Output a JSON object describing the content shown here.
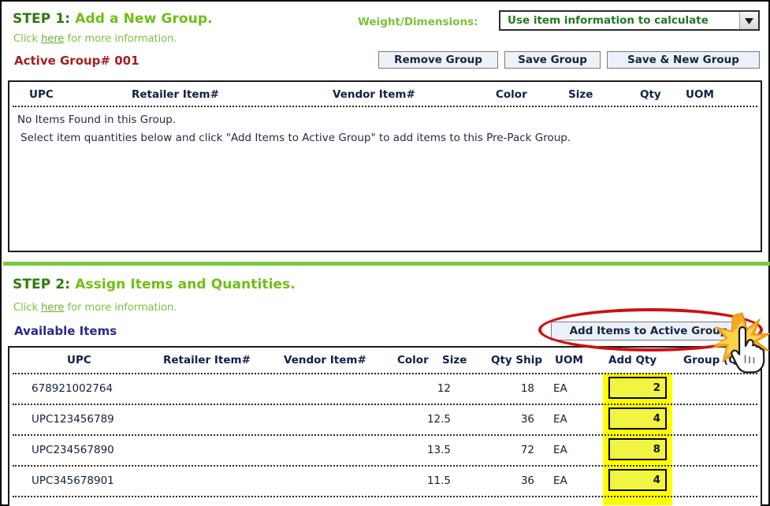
{
  "step1": {
    "heading_num": "STEP 1:",
    "heading_text": "Add a New Group.",
    "help_prefix": "Click ",
    "help_link": "here",
    "help_suffix": " for more information.",
    "active_group": "Active Group# 001",
    "weight_label": "Weight/Dimensions:",
    "weight_value": "Use item information to calculate",
    "buttons": {
      "remove": "Remove Group",
      "save": "Save Group",
      "save_new": "Save & New Group"
    },
    "table": {
      "headers": [
        "UPC",
        "Retailer Item#",
        "Vendor Item#",
        "Color",
        "Size",
        "Qty",
        "UOM"
      ],
      "empty_line1": "No Items Found in this Group.",
      "empty_line2": "Select item quantities below and click \"Add Items to Active Group\" to add items to this Pre-Pack Group."
    }
  },
  "step2": {
    "heading_num": "STEP 2:",
    "heading_text": "Assign Items and Quantities.",
    "help_prefix": "Click ",
    "help_link": "here",
    "help_suffix": " for more information.",
    "available_items": "Available Items",
    "add_button": "Add Items to Active Group",
    "table": {
      "headers": [
        "UPC",
        "Retailer Item#",
        "Vendor Item#",
        "Color",
        "Size",
        "Qty Ship",
        "UOM",
        "Add Qty",
        "Group (Q"
      ],
      "rows": [
        {
          "upc": "678921002764",
          "retailer_item": "",
          "vendor_item": "",
          "color": "",
          "size": "12",
          "qty_ship": "18",
          "uom": "EA",
          "add_qty": "2",
          "group": ""
        },
        {
          "upc": "UPC123456789",
          "retailer_item": "",
          "vendor_item": "",
          "color": "",
          "size": "12.5",
          "qty_ship": "36",
          "uom": "EA",
          "add_qty": "4",
          "group": ""
        },
        {
          "upc": "UPC234567890",
          "retailer_item": "",
          "vendor_item": "",
          "color": "",
          "size": "13.5",
          "qty_ship": "72",
          "uom": "EA",
          "add_qty": "8",
          "group": ""
        },
        {
          "upc": "UPC345678901",
          "retailer_item": "",
          "vendor_item": "",
          "color": "",
          "size": "11.5",
          "qty_ship": "36",
          "uom": "EA",
          "add_qty": "4",
          "group": ""
        }
      ]
    }
  },
  "annotation": {
    "highlight_shape": "red-ellipse",
    "cursor": "hand-pointer-click"
  },
  "colors": {
    "step_num": "#2d7a0b",
    "step_text": "#6ec014",
    "active_group": "#a62020",
    "available_items": "#2a2a8c",
    "header_text": "#10204a",
    "highlight_yellow": "#ffff00",
    "annotation_red": "#cc1111",
    "divider_green": "#7ac943"
  }
}
